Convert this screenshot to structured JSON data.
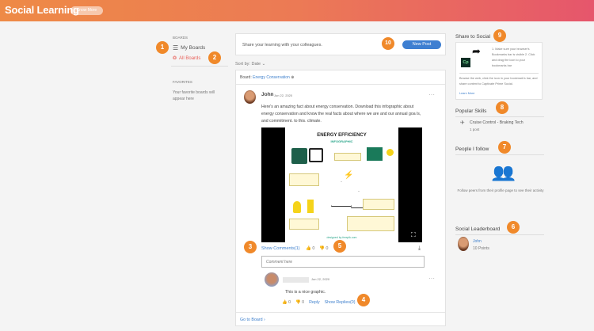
{
  "header": {
    "title": "Social Learning",
    "know_more": "Know More"
  },
  "left": {
    "boards_heading": "BOARDS",
    "my_boards": "My Boards",
    "all_boards": "All Boards",
    "favorites_heading": "FAVORITES",
    "favorites_empty": "Your favorite boards will appear here"
  },
  "composer": {
    "prompt": "Share your learning with your colleagues.",
    "new_post": "New Post"
  },
  "sort": {
    "label": "Sort by:",
    "value": "Date"
  },
  "post": {
    "board_label": "Board:",
    "board_name": "Energy Conservation",
    "author": "John",
    "date": "Jun 22, 2020",
    "body": "Here's an amazing fact about energy conservation. Download this infographic about energy conservation and know the real facts about where we are and our annual goa ls, and commitment. to this. climate.",
    "infographic_title": "ENERGY EFFICIENCY",
    "infographic_subtitle": "INFOGRAPHIC",
    "infographic_credit": "designed by freepik.com",
    "show_comments": "Show Comments(1)",
    "likes": "0",
    "dislikes": "0",
    "comment_placeholder": "Comment here",
    "go_to_board": "Go to Board"
  },
  "comment": {
    "date": "Jun 22, 2020",
    "text": "This is a nice graphic.",
    "likes": "0",
    "dislikes": "0",
    "reply": "Reply",
    "show_replies": "Show Replies(0)"
  },
  "right": {
    "share_title": "Share to Social",
    "share_steps": "1. Make sure your browser's Bookmarks bar is visible 2. Click and drag the icon to your bookmarks bar",
    "share_desc": "Browse the web, click the icon in your bookmark's bar, and share content to Captivate Prime Social.",
    "learn_more": "Learn More",
    "cp_logo": "Cp",
    "popular_title": "Popular Skills",
    "skill_name": "Cruise Control - Braking Tech",
    "skill_count": "1 post",
    "people_title": "People I follow",
    "people_empty": "Follow peers from their profile page to see their activity",
    "leaderboard_title": "Social Leaderboard",
    "leader_name": "John",
    "leader_points": "10 Points"
  },
  "badges": [
    "1",
    "2",
    "3",
    "4",
    "5",
    "6",
    "7",
    "8",
    "9",
    "10"
  ],
  "colors": {
    "accent": "#f0892a",
    "link": "#3d7fcc",
    "people": "#e86a6a"
  }
}
